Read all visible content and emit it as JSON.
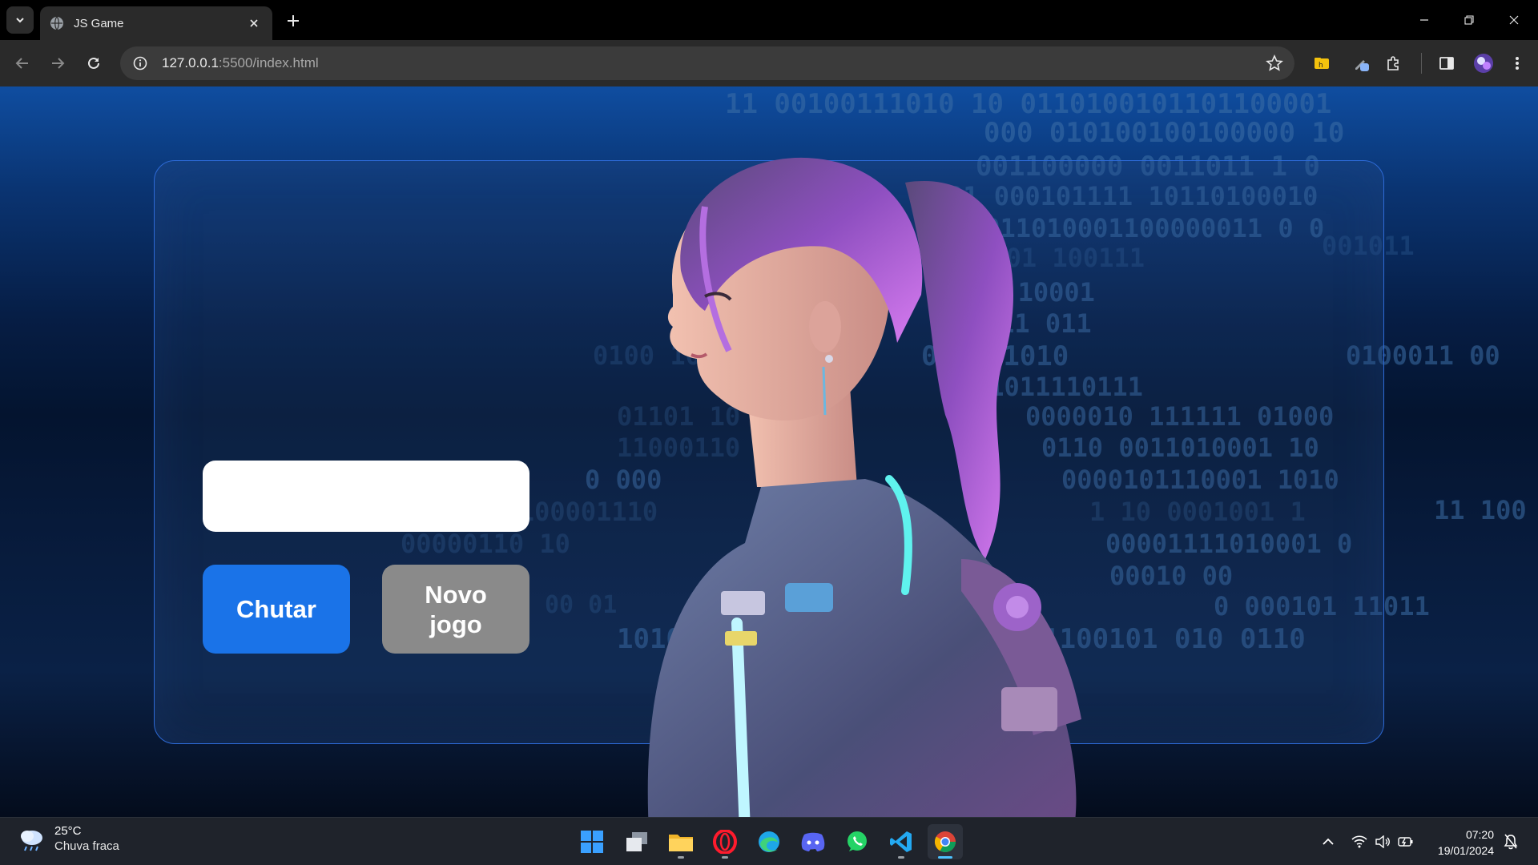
{
  "browser": {
    "tab_title": "JS Game",
    "url_host": "127.0.0.1",
    "url_rest": ":5500/index.html"
  },
  "page": {
    "input_value": "",
    "guess_button": "Chutar",
    "new_game_button": "Novo jogo",
    "background_binary": [
      "11 00100111010 10 0110100101101100001",
      "000 010100100100000 10",
      "001100000 0011011 1 0",
      "01 000101111 10110100010",
      "0011010001100000011 0 0",
      "010 1 01 100111",
      "11011 10001",
      "010111 011",
      "011111010",
      "01011110111",
      "0000010 111111 01000",
      "0110 0011010001 10",
      "0000101110001 1010",
      "1 10 0001001 1",
      "00001111010001 0",
      "00010 00",
      "0 000101 11011",
      "10100 010 11 1011011000 101100101 010 0110",
      "01101 10",
      "11000110",
      "0 000",
      "110100001110",
      "00000110 10",
      "00 01",
      "0100 10 0",
      "001011",
      "0100011 00",
      "11 100"
    ]
  },
  "taskbar": {
    "temperature": "25°C",
    "weather": "Chuva fraca",
    "time": "07:20",
    "date": "19/01/2024"
  },
  "colors": {
    "accent_blue": "#1a73e8",
    "button_gray": "#8a8a8a",
    "card_border": "#2d6ad6"
  }
}
